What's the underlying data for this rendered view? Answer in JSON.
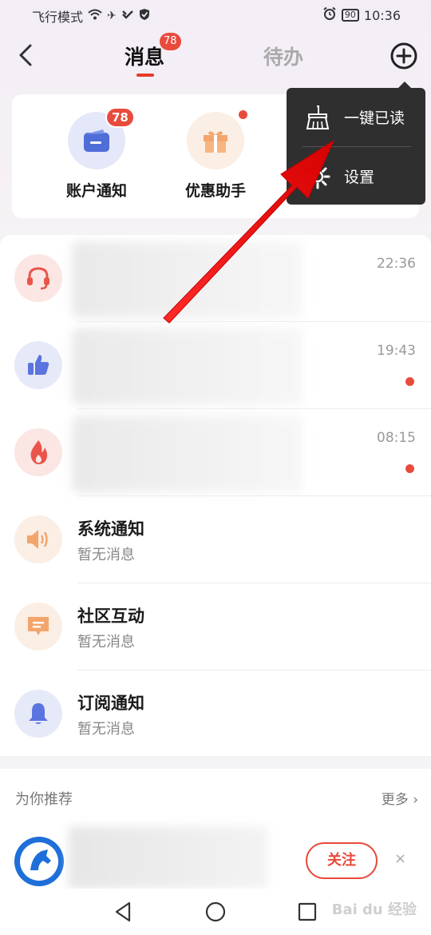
{
  "status_bar": {
    "left_text": "飞行模式",
    "battery": "90",
    "time": "10:36"
  },
  "header": {
    "tab_messages": "消息",
    "tab_messages_badge": "78",
    "tab_todo": "待办"
  },
  "quick_items": [
    {
      "label": "账户通知",
      "badge": "78"
    },
    {
      "label": "优惠助手"
    }
  ],
  "popup_menu": {
    "items": [
      {
        "label": "一键已读",
        "icon": "broom-icon"
      },
      {
        "label": "设置",
        "icon": "gear-icon"
      }
    ]
  },
  "messages": [
    {
      "icon": "headset-icon",
      "time": "22:36",
      "unread": false
    },
    {
      "icon": "thumbs-up-icon",
      "time": "19:43",
      "unread": true
    },
    {
      "icon": "fire-icon",
      "time": "08:15",
      "unread": true
    },
    {
      "icon": "speaker-icon",
      "title": "系统通知",
      "subtitle": "暂无消息"
    },
    {
      "icon": "chat-icon",
      "title": "社区互动",
      "subtitle": "暂无消息"
    },
    {
      "icon": "bell-icon",
      "title": "订阅通知",
      "subtitle": "暂无消息"
    }
  ],
  "recommend": {
    "title": "为你推荐",
    "more": "更多",
    "follow_label": "关注",
    "close": "×"
  },
  "watermark": "Bai du 经验",
  "colors": {
    "accent": "#e84b3c",
    "popup_bg": "#2f2f2f"
  }
}
